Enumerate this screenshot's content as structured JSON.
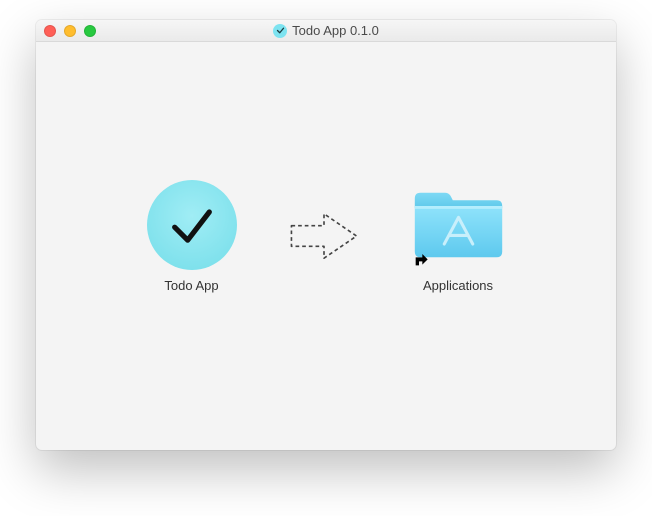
{
  "window": {
    "title": "Todo App 0.1.0"
  },
  "installer": {
    "app_label": "Todo App",
    "applications_label": "Applications"
  }
}
